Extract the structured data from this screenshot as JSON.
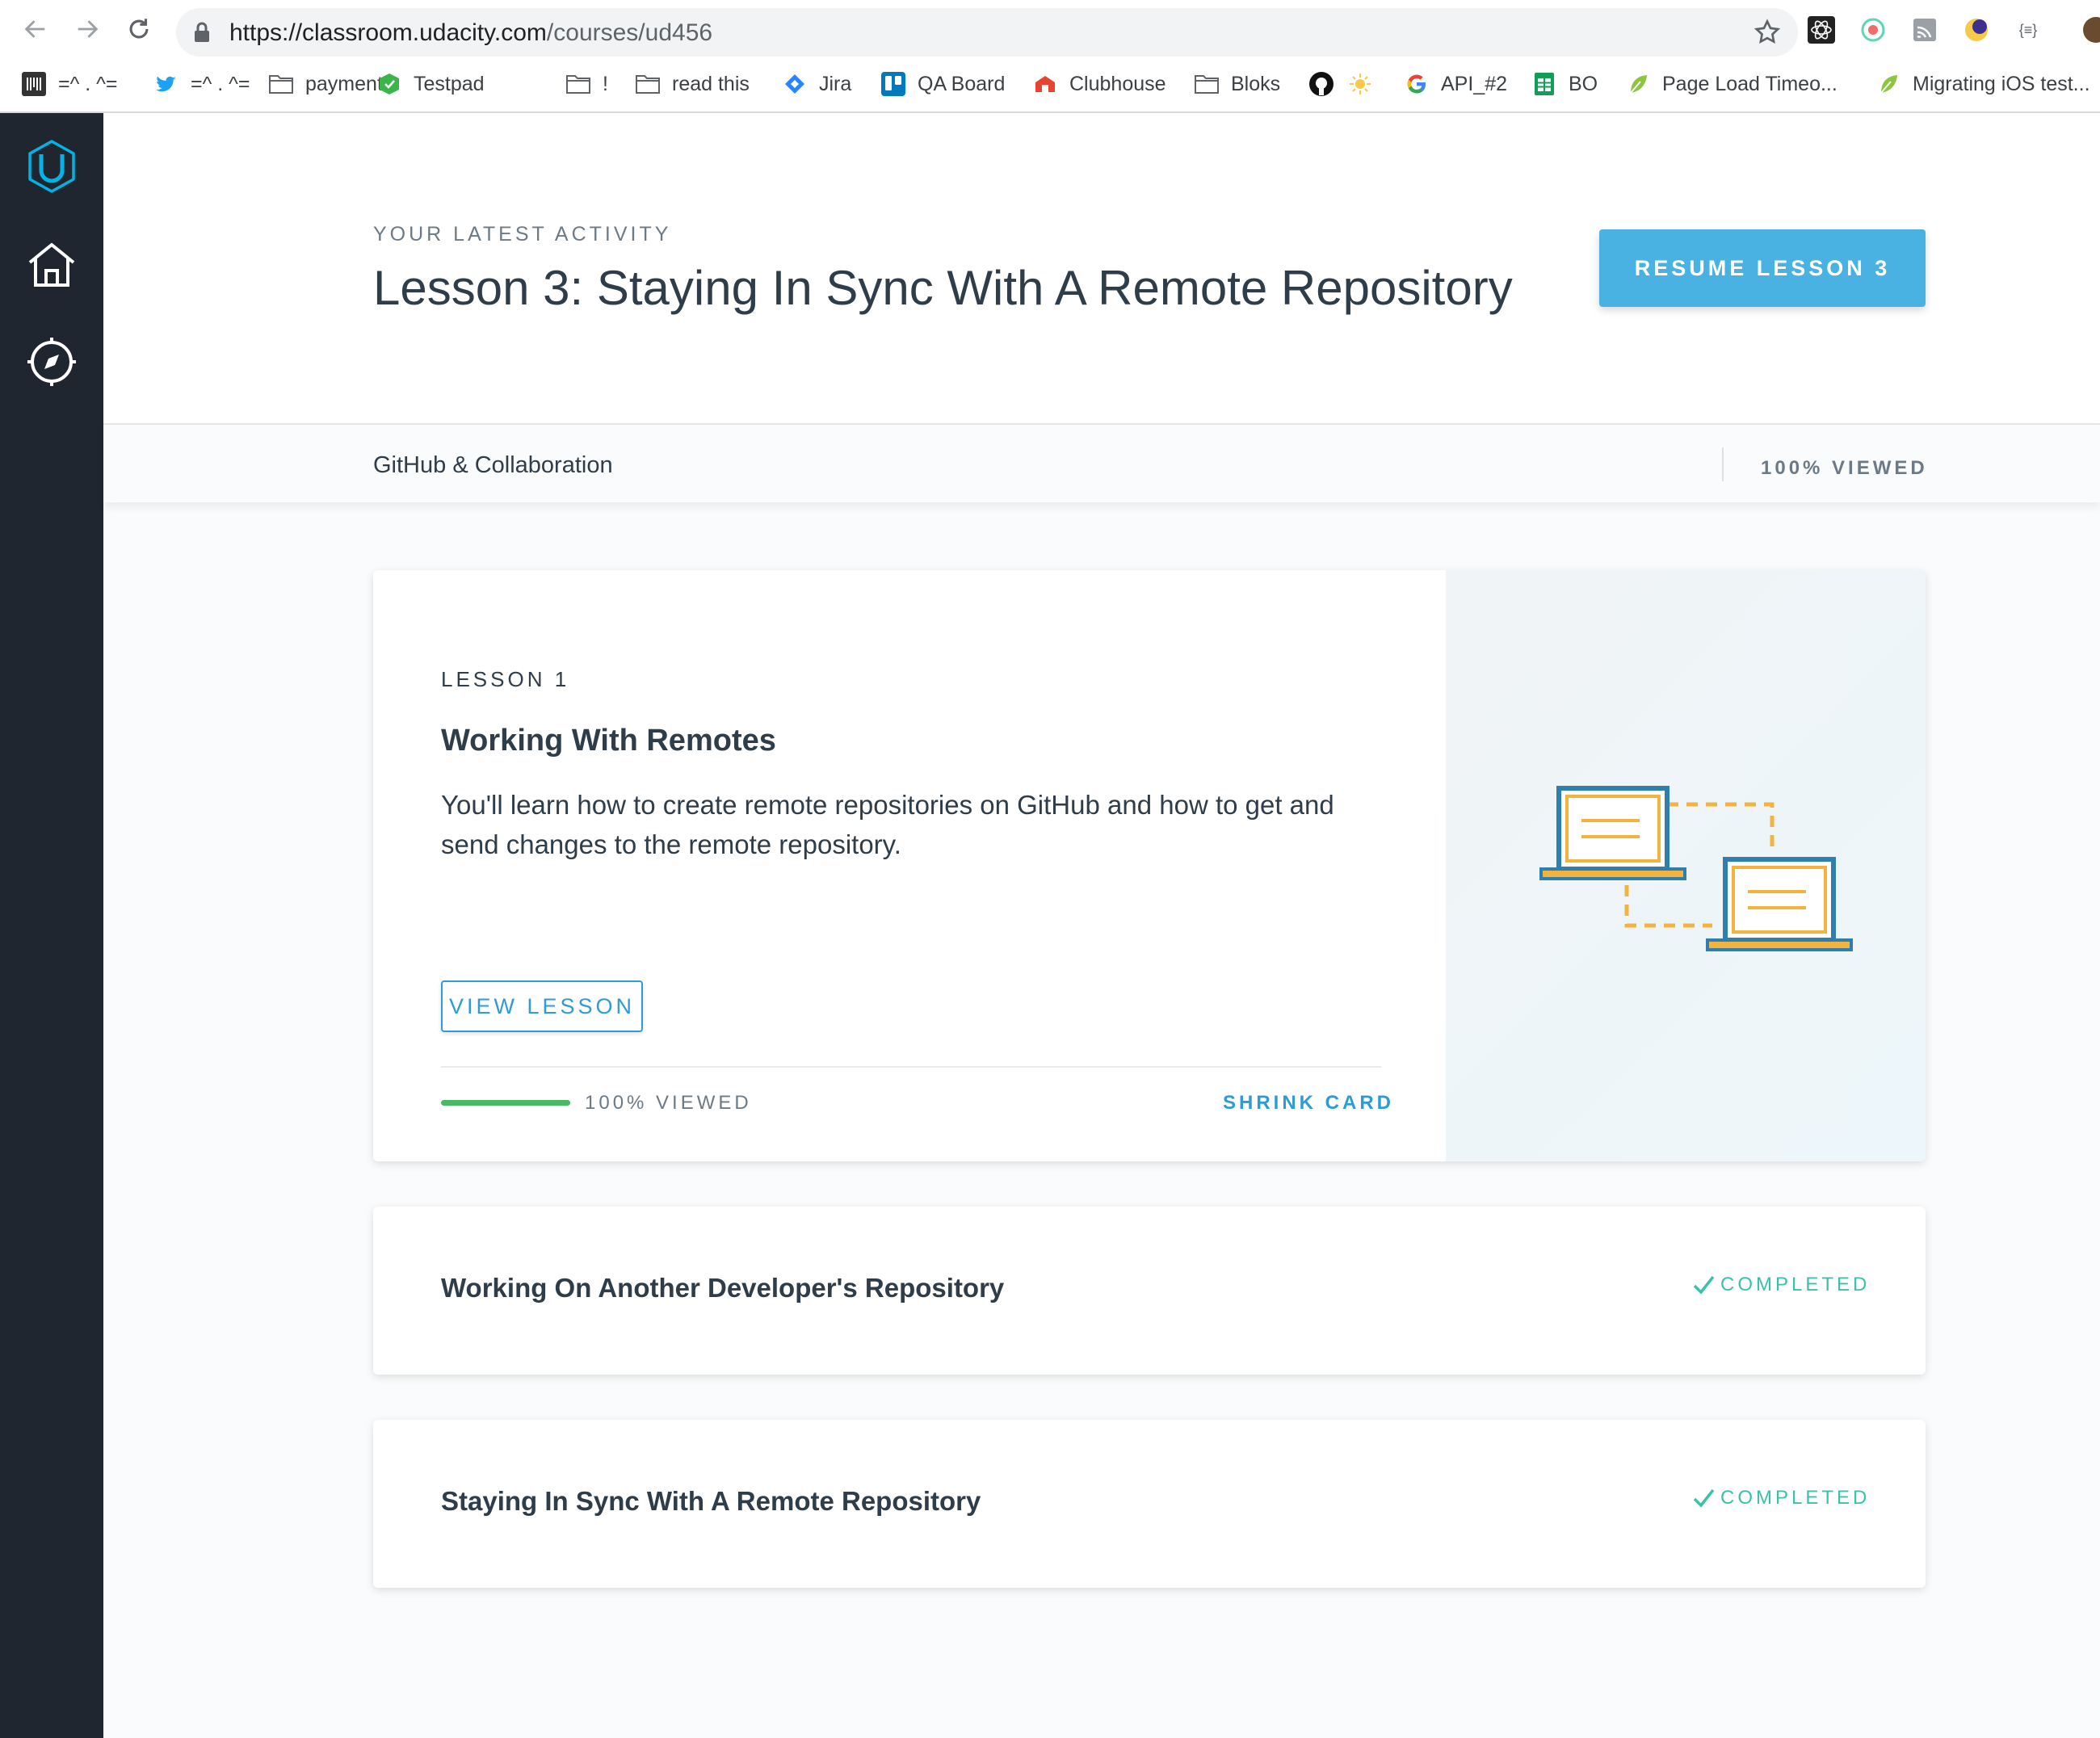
{
  "browser": {
    "url_host": "https://classroom.udacity.com",
    "url_path": "/courses/ud456",
    "bookmarks": [
      {
        "label": "=^ . ^=",
        "icon": "barcode-icon"
      },
      {
        "label": "=^ . ^=",
        "icon": "twitter-icon"
      },
      {
        "label": "payments",
        "icon": "folder-icon"
      },
      {
        "label": "Testpad",
        "icon": "testpad-icon"
      },
      {
        "label": "!",
        "icon": "folder-icon"
      },
      {
        "label": "read this",
        "icon": "folder-icon"
      },
      {
        "label": "Jira",
        "icon": "jira-icon"
      },
      {
        "label": "QA Board",
        "icon": "trello-icon"
      },
      {
        "label": "Clubhouse",
        "icon": "clubhouse-icon"
      },
      {
        "label": "Bloks",
        "icon": "folder-icon"
      },
      {
        "label": "",
        "icon": "github-icon"
      },
      {
        "label": "",
        "icon": "sun-icon"
      },
      {
        "label": "API_#2",
        "icon": "google-icon"
      },
      {
        "label": "BO",
        "icon": "sheets-icon"
      },
      {
        "label": "Page Load Timeo...",
        "icon": "leaf-icon"
      },
      {
        "label": "Migrating iOS test...",
        "icon": "leaf-icon"
      }
    ]
  },
  "header": {
    "eyebrow": "YOUR LATEST ACTIVITY",
    "title": "Lesson 3: Staying In Sync With A Remote Repository",
    "resume_label": "RESUME LESSON 3"
  },
  "course": {
    "name": "GitHub & Collaboration",
    "viewed": "100% VIEWED"
  },
  "lessons": [
    {
      "label": "LESSON 1",
      "title": "Working With Remotes",
      "description": "You'll learn how to create remote repositories on GitHub and how to get and send changes to the remote repository.",
      "view_label": "VIEW LESSON",
      "progress": 1.0,
      "viewed_label": "100% VIEWED",
      "shrink_label": "SHRINK CARD"
    },
    {
      "title": "Working On Another Developer's Repository",
      "status": "COMPLETED"
    },
    {
      "title": "Staying In Sync With A Remote Repository",
      "status": "COMPLETED"
    }
  ],
  "colors": {
    "accent": "#4ab2e2",
    "link": "#2e9bd6",
    "sidebar": "#1f2630",
    "completed": "#3cc0a8",
    "progress": "#4bb865"
  }
}
